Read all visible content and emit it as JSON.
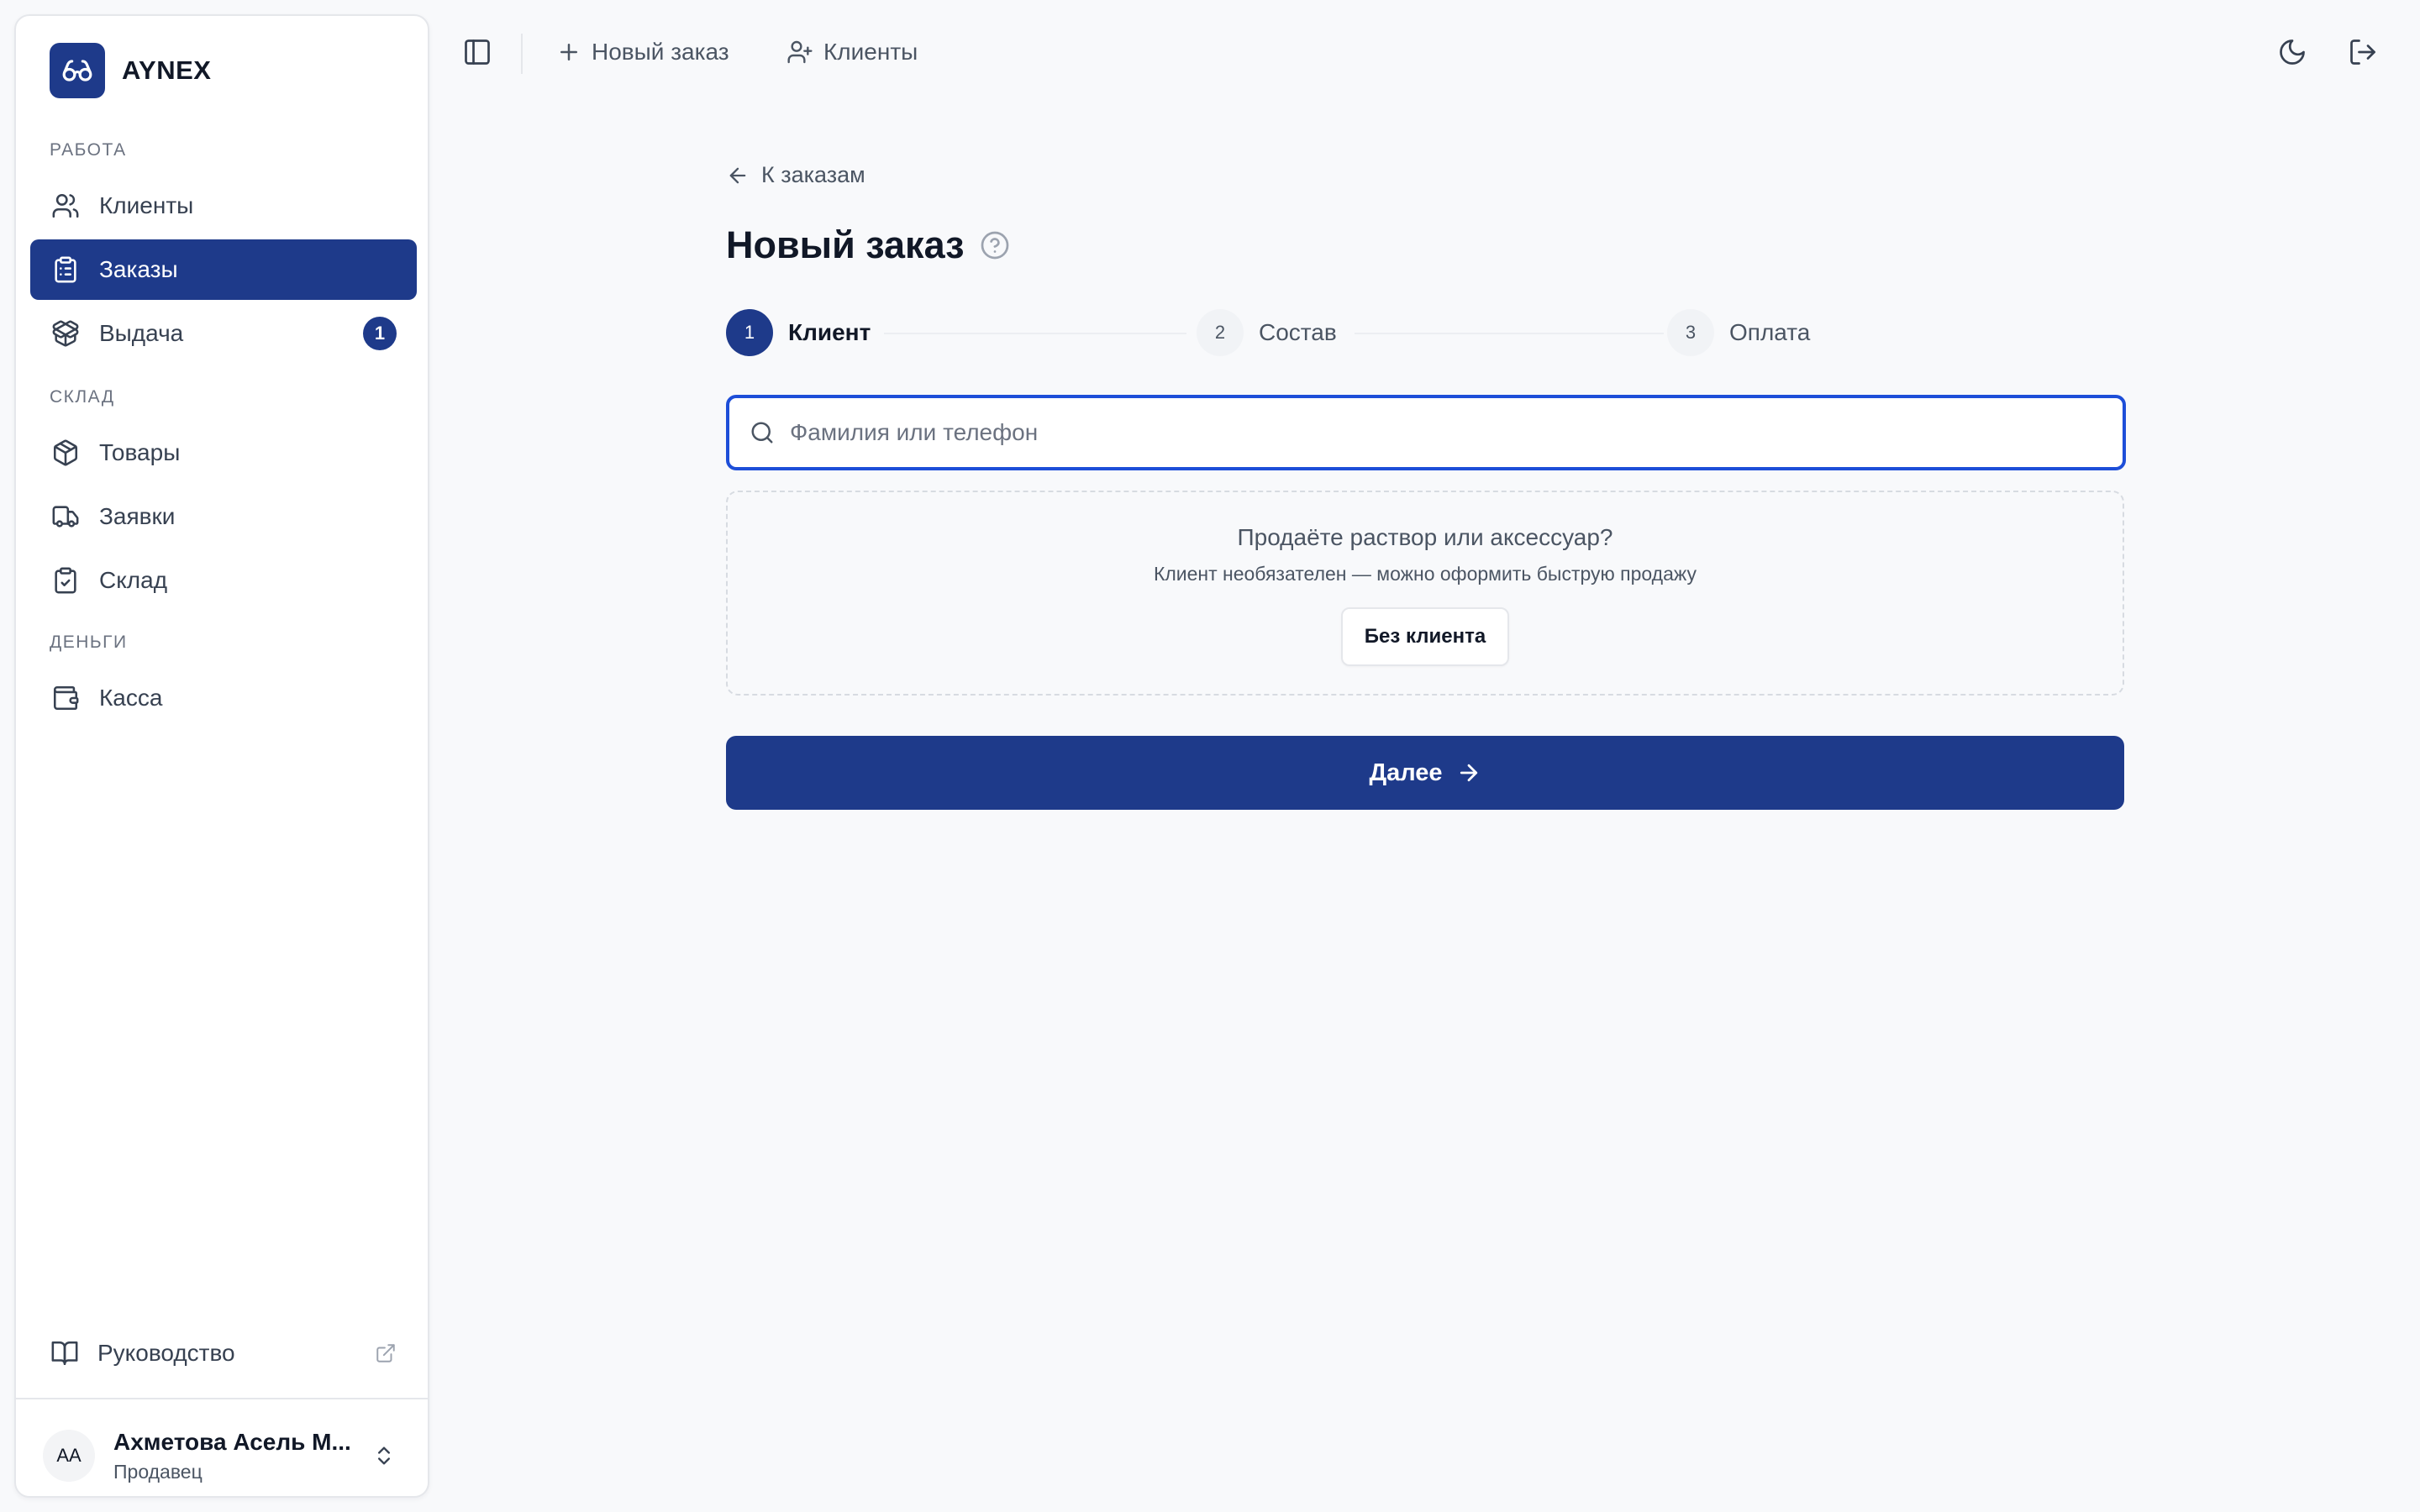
{
  "app": {
    "brand_name": "AYNEX",
    "brand_color": "#1e3a8a",
    "focus_color": "#1d4ed8"
  },
  "sidebar": {
    "sections": [
      {
        "label": "РАБОТА",
        "items": [
          {
            "label": "Клиенты",
            "icon": "users-icon"
          },
          {
            "label": "Заказы",
            "icon": "clipboard-list-icon",
            "active": true
          },
          {
            "label": "Выдача",
            "icon": "package-open-icon",
            "badge": "1"
          }
        ]
      },
      {
        "label": "СКЛАД",
        "items": [
          {
            "label": "Товары",
            "icon": "package-icon"
          },
          {
            "label": "Заявки",
            "icon": "truck-icon"
          },
          {
            "label": "Склад",
            "icon": "clipboard-check-icon"
          }
        ]
      },
      {
        "label": "ДЕНЬГИ",
        "items": [
          {
            "label": "Касса",
            "icon": "wallet-icon"
          }
        ]
      }
    ],
    "guide": {
      "label": "Руководство",
      "icon": "book-open-icon",
      "ext_icon": "external-link-icon"
    },
    "user": {
      "initials": "АА",
      "name": "Ахметова Асель М...",
      "role": "Продавец"
    }
  },
  "topbar": {
    "new_order_label": "Новый заказ",
    "clients_label": "Клиенты"
  },
  "main": {
    "back_label": "К заказам",
    "title": "Новый заказ",
    "steps": [
      {
        "number": "1",
        "label": "Клиент",
        "active": true
      },
      {
        "number": "2",
        "label": "Состав",
        "active": false
      },
      {
        "number": "3",
        "label": "Оплата",
        "active": false
      }
    ],
    "search": {
      "placeholder": "Фамилия или телефон",
      "value": ""
    },
    "quick_sale": {
      "title": "Продаёте раствор или аксессуар?",
      "subtitle": "Клиент необязателен — можно оформить быструю продажу",
      "button_label": "Без клиента"
    },
    "next_label": "Далее"
  }
}
